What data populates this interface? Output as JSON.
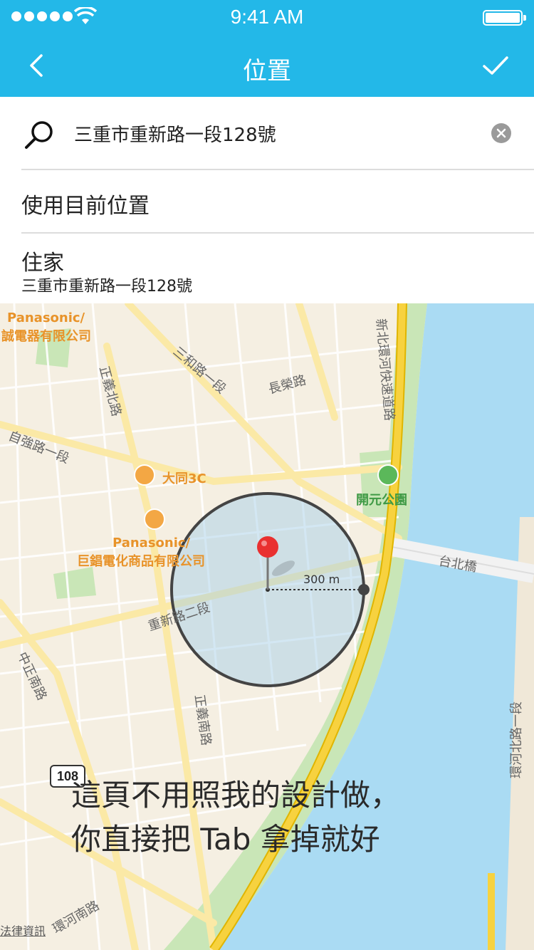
{
  "status_bar": {
    "time": "9:41 AM"
  },
  "nav": {
    "title": "位置",
    "back_icon": "chevron-left-icon",
    "confirm_icon": "checkmark-icon"
  },
  "search": {
    "value": "三重市重新路一段128號",
    "icon": "search-icon",
    "clear_icon": "clear-icon"
  },
  "options": {
    "current_location_label": "使用目前位置",
    "home": {
      "label": "住家",
      "address": "三重市重新路一段128號"
    }
  },
  "map": {
    "pois": {
      "panasonic_1a": "Panasonic/",
      "panasonic_1b": "誠電器有限公司",
      "datong": "大同3C",
      "panasonic_2a": "Panasonic/",
      "panasonic_2b": "巨錩電化商品有限公司",
      "park": "開元公園",
      "legal": "法律資訊"
    },
    "roads": {
      "sanhe": "三和路一段",
      "changrong": "長榮路",
      "zhengyi_north": "正義北路",
      "ziqiang": "自強路一段",
      "xinbei": "新北環河快速道路",
      "taipei_bridge": "台北橋",
      "chongxin": "重新路二段",
      "zhongzheng_south": "中正南路",
      "zhengyi_south": "正義南路",
      "huanhe_north": "環河北路一段",
      "huanhe_south": "環河南路",
      "route_108": "108"
    },
    "radius_label": "300 m"
  },
  "overlay_note": {
    "line1": "這頁不用照我的設計做，",
    "line2": "你直接把 Tab 拿掉就好"
  },
  "colors": {
    "nav_bg": "#23b8e8",
    "map_land": "#f5efe2",
    "map_water": "#aadbf3",
    "map_park": "#c9e6b7",
    "highway": "#f7d23f",
    "pin": "#e93030"
  }
}
